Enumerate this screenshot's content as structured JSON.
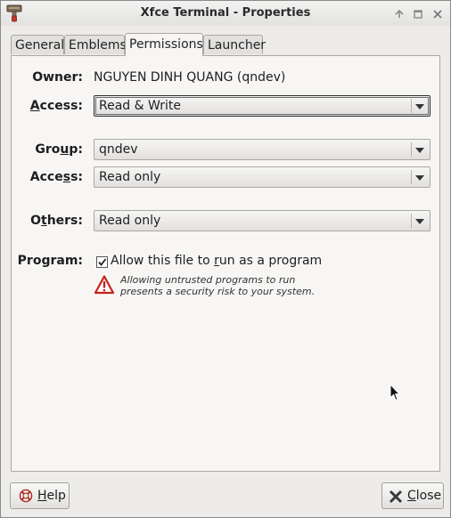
{
  "window": {
    "title": "Xfce Terminal - Properties",
    "buttons": [
      "up",
      "maximize",
      "close"
    ]
  },
  "tabs": [
    {
      "label": "General",
      "active": false
    },
    {
      "label": "Emblems",
      "active": false
    },
    {
      "label": "Permissions",
      "active": true
    },
    {
      "label": "Launcher",
      "active": false
    }
  ],
  "permissions": {
    "owner_label": "Owner:",
    "owner_value": "NGUYEN DINH QUANG (qndev)",
    "owner_access_label_pre": "",
    "owner_access_label_u": "A",
    "owner_access_label_post": "ccess:",
    "owner_access_value": "Read & Write",
    "group_label_pre": "Gro",
    "group_label_u": "u",
    "group_label_post": "p:",
    "group_value": "qndev",
    "group_access_label_pre": "Acce",
    "group_access_label_u": "s",
    "group_access_label_post": "s:",
    "group_access_value": "Read only",
    "others_label_pre": "O",
    "others_label_u": "t",
    "others_label_post": "hers:",
    "others_value": "Read only",
    "program_label": "Program:",
    "program_check_pre": "Allow this file to ",
    "program_check_u": "r",
    "program_check_post": "un as a program",
    "program_checked": true,
    "warning_line1": "Allowing untrusted programs to run",
    "warning_line2": "presents a security risk to your system."
  },
  "footer": {
    "help_pre": "",
    "help_u": "H",
    "help_post": "elp",
    "close_pre": "",
    "close_u": "C",
    "close_post": "lose"
  },
  "icons": {
    "app": "terminal-brush-icon",
    "warning": "warning-triangle-icon",
    "help": "help-lifebuoy-icon",
    "close": "close-x-icon"
  },
  "colors": {
    "warning_red": "#c4231c",
    "window_bg": "#edeceb",
    "panel_bg": "#f7f6f5"
  }
}
